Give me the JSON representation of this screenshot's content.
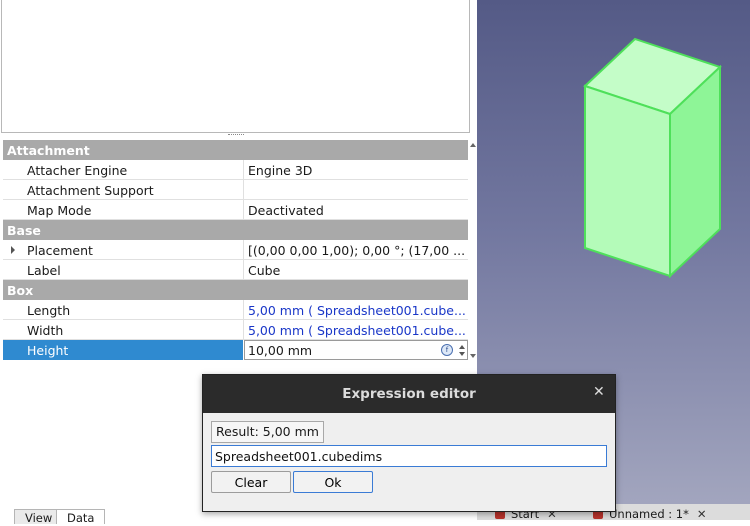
{
  "property_view": {
    "groups": [
      {
        "name": "Attachment",
        "props": [
          {
            "name": "Attacher Engine",
            "value": "Engine 3D"
          },
          {
            "name": "Attachment Support",
            "value": ""
          },
          {
            "name": "Map Mode",
            "value": "Deactivated"
          }
        ]
      },
      {
        "name": "Base",
        "props": [
          {
            "name": "Placement",
            "value": "[(0,00 0,00 1,00); 0,00 °; (17,00 ..."
          },
          {
            "name": "Label",
            "value": "Cube"
          }
        ]
      },
      {
        "name": "Box",
        "props": [
          {
            "name": "Length",
            "value": "5,00 mm  ( Spreadsheet001.cube..."
          },
          {
            "name": "Width",
            "value": "5,00 mm  ( Spreadsheet001.cube..."
          },
          {
            "name": "Height",
            "value": "10,00 mm"
          }
        ]
      }
    ]
  },
  "bottom_tabs": [
    "View",
    "Data"
  ],
  "doc_tabs": [
    {
      "label": "Start",
      "close": "✕"
    },
    {
      "label": "Unnamed : 1*",
      "close": "✕"
    }
  ],
  "dialog": {
    "title": "Expression editor",
    "close": "✕",
    "result": "Result: 5,00 mm",
    "expression": "Spreadsheet001.cubedims",
    "clear_label": "Clear",
    "ok_label": "Ok"
  },
  "icons": {
    "expression": "fx-icon",
    "doc": "freecad-doc-icon"
  },
  "colors": {
    "selection": "#2f8ad0",
    "group_header": "#a9a9a9",
    "expression_bound_text": "#1a37c8",
    "cube_face": "#9ff5a6",
    "cube_edge": "#4ee05a"
  }
}
